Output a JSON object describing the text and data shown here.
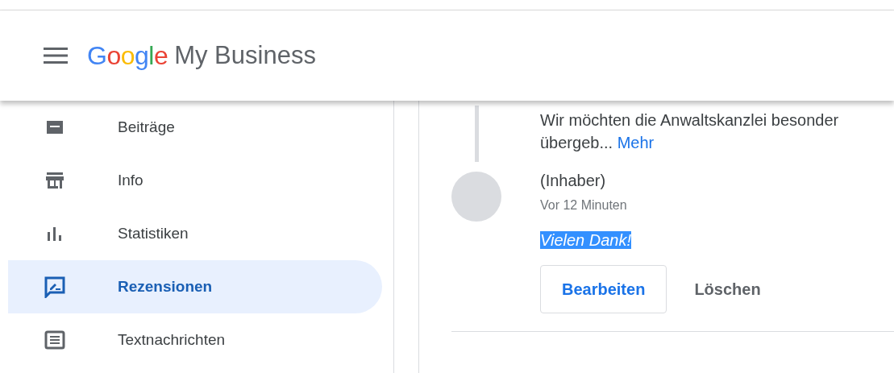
{
  "header": {
    "brand": "Google",
    "product": "My Business"
  },
  "sidebar": {
    "items": [
      {
        "label": "Beiträge",
        "kind": "posts",
        "selected": false
      },
      {
        "label": "Info",
        "kind": "store",
        "selected": false
      },
      {
        "label": "Statistiken",
        "kind": "stats",
        "selected": false
      },
      {
        "label": "Rezensionen",
        "kind": "reviews",
        "selected": true
      },
      {
        "label": "Textnachrichten",
        "kind": "messages",
        "selected": false
      }
    ]
  },
  "review": {
    "text_lines": [
      "Wir möchten die Anwaltskanzlei besonder",
      "übergeb..."
    ],
    "more_link": "Mehr"
  },
  "reply": {
    "author": "(Inhaber)",
    "time": "Vor 12 Minuten",
    "text": "Vielen Dank!",
    "text_selected": true,
    "buttons": [
      {
        "label": "Bearbeiten",
        "kind": "outlined"
      },
      {
        "label": "Löschen",
        "kind": "text"
      }
    ]
  }
}
